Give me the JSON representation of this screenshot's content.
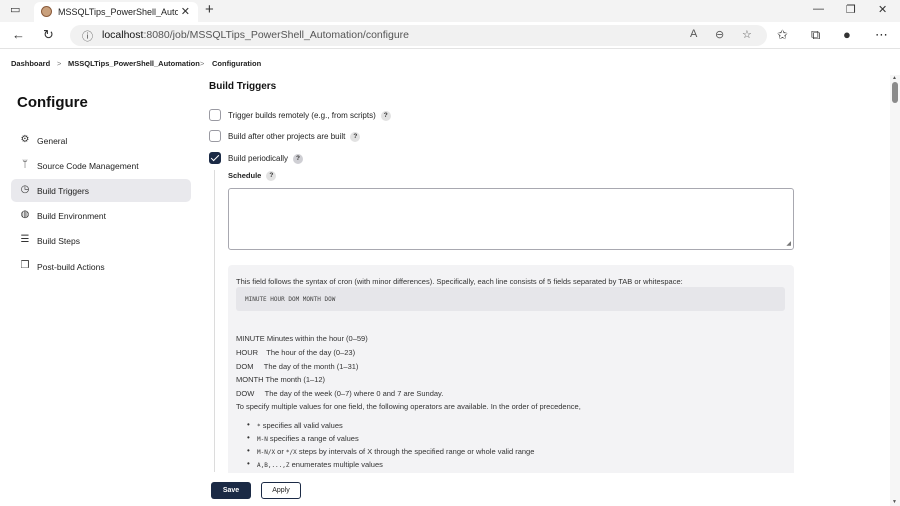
{
  "browser": {
    "tab_title": "MSSQLTips_PowerShell_Automat",
    "tab_close": "✕",
    "new_tab": "+",
    "url_host": "localhost",
    "url_rest": ":8080/job/MSSQLTips_PowerShell_Automation/configure",
    "icons": [
      "back-arrow-icon",
      "refresh-icon",
      "info-icon",
      "read-aloud-icon",
      "zoom-icon",
      "favorite-add-icon",
      "favorites-icon",
      "collections-icon",
      "profile-icon",
      "more-icon"
    ]
  },
  "breadcrumb": {
    "items": [
      "Dashboard",
      "MSSQLTips_PowerShell_Automation",
      "Configuration"
    ],
    "separator": ">"
  },
  "sidebar": {
    "title": "Configure",
    "items": [
      {
        "label": "General",
        "icon": "gear-icon"
      },
      {
        "label": "Source Code Management",
        "icon": "branch-icon"
      },
      {
        "label": "Build Triggers",
        "icon": "clock-icon"
      },
      {
        "label": "Build Environment",
        "icon": "globe-icon"
      },
      {
        "label": "Build Steps",
        "icon": "list-icon"
      },
      {
        "label": "Post-build Actions",
        "icon": "cube-icon"
      }
    ],
    "active_index": 2
  },
  "main": {
    "section_title": "Build Triggers",
    "options": [
      {
        "label": "Trigger builds remotely (e.g., from scripts)",
        "checked": false
      },
      {
        "label": "Build after other projects are built",
        "checked": false
      },
      {
        "label": "Build periodically",
        "checked": true
      }
    ],
    "help_mark": "?",
    "schedule_label": "Schedule",
    "schedule_value": "",
    "help": {
      "intro": "This field follows the syntax of cron (with minor differences). Specifically, each line consists of 5 fields separated by TAB or whitespace:",
      "code": "MINUTE HOUR DOM MONTH DOW",
      "fields": [
        "MINUTE Minutes within the hour (0–59)",
        "HOUR    The hour of the day (0–23)",
        "DOM     The day of the month (1–31)",
        "MONTH The month (1–12)",
        "DOW     The day of the week (0–7) where 0 and 7 are Sunday."
      ],
      "operators_intro": "To specify multiple values for one field, the following operators are available. In the order of precedence,",
      "bullets": [
        {
          "code": "*",
          "text": " specifies all valid values"
        },
        {
          "code": "M-N",
          "text": " specifies a range of values"
        },
        {
          "code": "M-N/X",
          "text": " or ",
          "code2": "*/X",
          "text2": " steps by intervals of X through the specified range or whole valid range"
        },
        {
          "code": "A,B,...,Z",
          "text": " enumerates multiple values"
        }
      ]
    }
  },
  "footer": {
    "save_label": "Save",
    "apply_label": "Apply"
  },
  "colors": {
    "primary": "#1b2a45",
    "active_item": "#e9e9ed",
    "help_bg": "#f3f3f5"
  }
}
